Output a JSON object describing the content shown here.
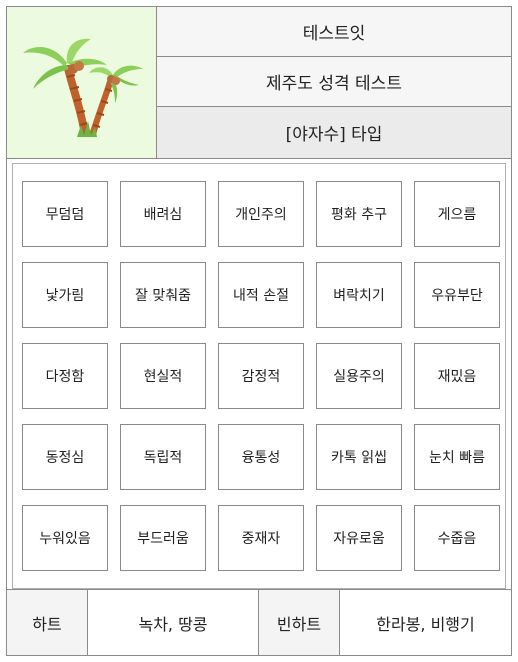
{
  "header": {
    "logo_icon": "palm-tree-icon",
    "app_name": "테스트잇",
    "test_name": "제주도 성격 테스트",
    "result_type": "[야자수] 타입"
  },
  "traits": [
    "무덤덤",
    "배려심",
    "개인주의",
    "평화 추구",
    "게으름",
    "낯가림",
    "잘 맞춰줌",
    "내적 손절",
    "벼락치기",
    "우유부단",
    "다정함",
    "현실적",
    "감정적",
    "실용주의",
    "재밌음",
    "동정심",
    "독립적",
    "융통성",
    "카톡 읽씹",
    "눈치 빠름",
    "누워있음",
    "부드러움",
    "중재자",
    "자유로움",
    "수줍음"
  ],
  "footer": {
    "heart_label": "하트",
    "heart_value": "녹차, 땅콩",
    "broken_heart_label": "빈하트",
    "broken_heart_value": "한라봉, 비행기"
  },
  "colors": {
    "logo_background": "#ecfbdf",
    "border": "#8a8a8a",
    "result_row_background": "#ebebeb"
  }
}
